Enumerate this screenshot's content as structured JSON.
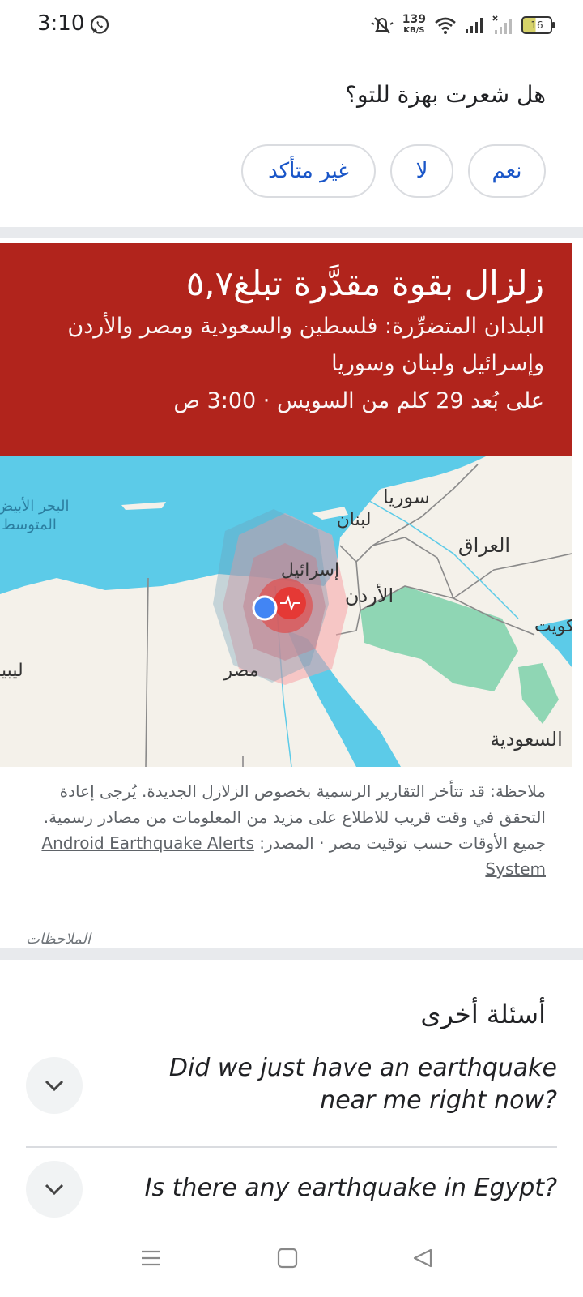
{
  "status_bar": {
    "time": "3:10",
    "speed_value": "139",
    "speed_unit": "KB/S",
    "battery": "16",
    "icons": [
      "whatsapp-icon",
      "mute-icon",
      "wifi-icon",
      "signal-icon",
      "no-signal-icon",
      "battery-icon"
    ]
  },
  "felt_prompt": {
    "question": "هل شعرت بهزة للتو؟",
    "options": {
      "yes": "نعم",
      "no": "لا",
      "unsure": "غير متأكد"
    }
  },
  "alert": {
    "title": "زلزال بقوة مقدَّرة تبلغ٥,٧",
    "countries": "البلدان المتضرِّرة: فلسطين والسعودية ومصر والأردن وإسرائيل ولبنان وسوريا",
    "distance_time": "على بُعد 29 كلم من السويس · 3:00 ص",
    "color": "#b1241c"
  },
  "map": {
    "labels": {
      "syria": "سوريا",
      "lebanon": "لبنان",
      "iraq": "العراق",
      "israel": "إسرائيل",
      "jordan": "الأردن",
      "kuwait": "الكويت",
      "egypt": "مصر",
      "libya": "ليبيا",
      "saudi": "السعودية",
      "med_sea_1": "البحر الأبيض",
      "med_sea_2": "المتوسط"
    },
    "colors": {
      "sea": "#5ccbe8",
      "land": "#f4f1ea",
      "epicenter": "#e53935",
      "user": "#4285f4"
    }
  },
  "note": {
    "text": "ملاحظة: قد تتأخر التقارير الرسمية بخصوص الزلازل الجديدة. يُرجى إعادة التحقق في وقت قريب للاطلاع على مزيد من المعلومات من مصادر رسمية.",
    "times": "جميع الأوقات حسب توقيت مصر · المصدر: ",
    "source_link": "Android Earthquake Alerts System"
  },
  "notes_link": "الملاحظات",
  "other_questions": {
    "title": "أسئلة أخرى",
    "items": [
      {
        "q": "Did we just have an earthquake near me right now?"
      },
      {
        "q": "Is there any earthquake in Egypt?"
      }
    ]
  }
}
